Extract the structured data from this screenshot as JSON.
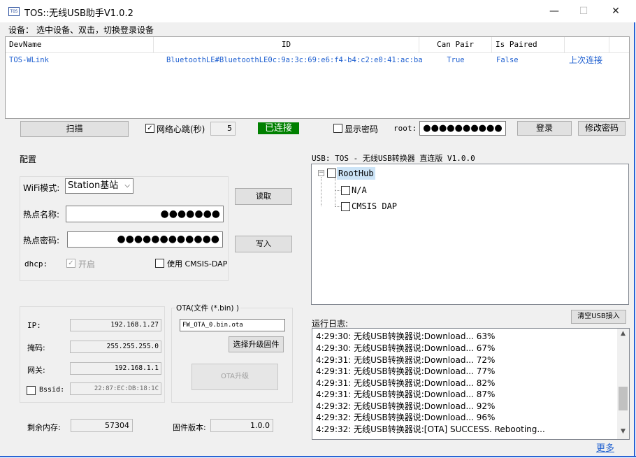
{
  "window": {
    "title": "TOS::无线USB助手V1.0.2",
    "icon_text": "TOS",
    "minimize": "—",
    "maximize": "☐",
    "close": "✕"
  },
  "devices": {
    "label": "设备：",
    "hint": "选中设备、双击，切换登录设备",
    "columns": [
      "DevName",
      "ID",
      "Can Pair",
      "Is Paired"
    ],
    "rows": [
      {
        "name": "TOS-WLink",
        "id": "BluetoothLE#BluetoothLE0c:9a:3c:69:e6:f4-b4:c2:e0:41:ac:ba",
        "can_pair": "True",
        "is_paired": "False",
        "action": "上次连接"
      }
    ]
  },
  "toolbar": {
    "scan": "扫描",
    "heartbeat_label": "网络心跳(秒)",
    "heartbeat_checked": true,
    "heartbeat_value": "5",
    "status": "已连接",
    "show_password": "显示密码",
    "user": "root:",
    "password_mask": "●●●●●●●●●●",
    "login": "登录",
    "change_password": "修改密码"
  },
  "config": {
    "title": "配置",
    "wifi_mode_label": "WiFi模式:",
    "wifi_mode_value": "Station基站",
    "ssid_label": "热点名称:",
    "ssid_mask": "●●●●●●●",
    "pwd_label": "热点密码:",
    "pwd_mask": "●●●●●●●●●●●●",
    "read": "读取",
    "write": "写入",
    "dhcp_label": "dhcp:",
    "dhcp_option": "开启",
    "dhcp_checked": true,
    "use_cmsis": "使用 CMSIS-DAP",
    "ip_label": "IP:",
    "ip_value": "192.168.1.27",
    "mask_label": "掩码:",
    "mask_value": "255.255.255.0",
    "gateway_label": "网关:",
    "gateway_value": "192.168.1.1",
    "bssid_label": "Bssid:",
    "bssid_value": "22:87:EC:DB:18:1C",
    "ota_title": "OTA(文件 (*.bin) )",
    "ota_file": "FW_OTA_0.bin.ota",
    "select_fw": "选择升级固件",
    "ota_upgrade": "OTA升级",
    "free_mem_label": "剩余内存:",
    "free_mem_value": "57304",
    "fw_version_label": "固件版本:",
    "fw_version_value": "1.0.0"
  },
  "usb": {
    "title": "USB: TOS - 无线USB转换器 直连版 V1.0.0",
    "tree": {
      "root": "RootHub",
      "children": [
        "N/A",
        "CMSIS DAP"
      ]
    }
  },
  "log": {
    "title": "运行日志:",
    "clear": "清空USB接入",
    "lines": [
      "4:29:30:  无线USB转换器说:Download... 63%",
      "4:29:30:  无线USB转换器说:Download... 67%",
      "4:29:31:  无线USB转换器说:Download... 72%",
      "4:29:31:  无线USB转换器说:Download... 77%",
      "4:29:31:  无线USB转换器说:Download... 82%",
      "4:29:31:  无线USB转换器说:Download... 87%",
      "4:29:32:  无线USB转换器说:Download... 92%",
      "4:29:32:  无线USB转换器说:Download... 96%",
      "4:29:32:  无线USB转换器说:[OTA] SUCCESS. Rebooting..."
    ],
    "more": "更多"
  },
  "colors": {
    "accent_blue": "#1e5fd0",
    "status_bg": "#008000",
    "status_fg": "#ffffff",
    "window_border": "#2a63d4"
  }
}
